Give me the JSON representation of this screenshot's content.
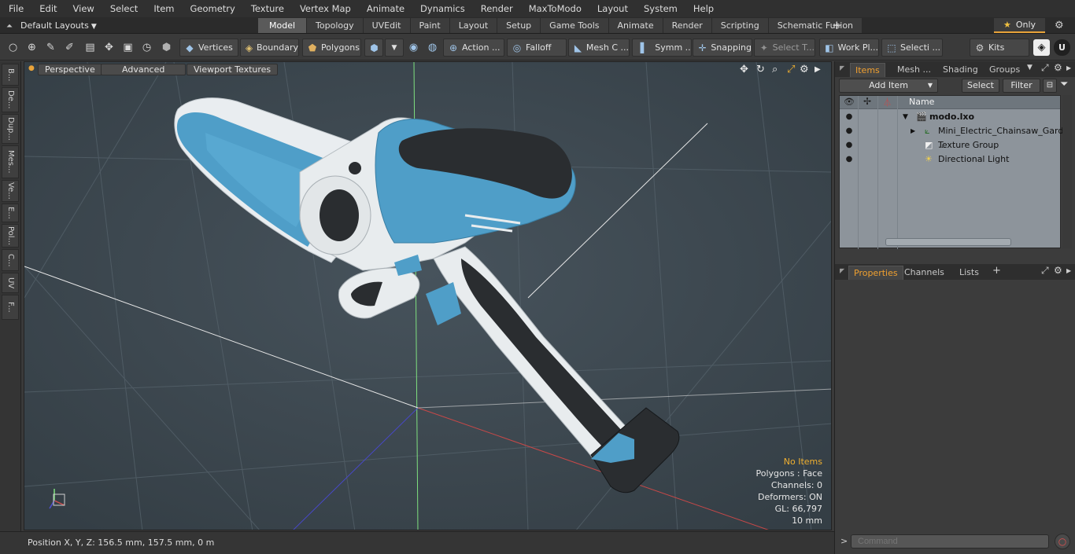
{
  "menu": [
    "File",
    "Edit",
    "View",
    "Select",
    "Item",
    "Geometry",
    "Texture",
    "Vertex Map",
    "Animate",
    "Dynamics",
    "Render",
    "MaxToModo",
    "Layout",
    "System",
    "Help"
  ],
  "layouts": {
    "selector": "Default Layouts",
    "tabs": [
      "Model",
      "Topology",
      "UVEdit",
      "Paint",
      "Layout",
      "Setup",
      "Game Tools",
      "Animate",
      "Render",
      "Scripting",
      "Schematic Fusion"
    ],
    "active_tab": "Model",
    "plus": "+",
    "only_label": "Only",
    "only_star": "★"
  },
  "toolbar": {
    "vertices": "Vertices",
    "boundary": "Boundary",
    "polygons": "Polygons",
    "action": "Action ...",
    "falloff": "Falloff",
    "mesh": "Mesh C ...",
    "symm": "Symm ...",
    "snapping": "Snapping",
    "select_t": "Select T...",
    "work_plane": "Work Pl...",
    "selection": "Selecti ...",
    "kits": "Kits"
  },
  "left_strip": [
    "B...",
    "De...",
    "Dup...",
    "Mes...",
    "Ve...",
    "E...",
    "Pol...",
    "C...",
    "UV",
    "F..."
  ],
  "viewport": {
    "view_mode": "Perspective",
    "shading": "Advanced",
    "textures": "Viewport Textures",
    "info": {
      "selection": "No Items",
      "polygons": "Polygons : Face",
      "channels": "Channels: 0",
      "deformers": "Deformers: ON",
      "gl": "GL: 66,797",
      "grid": "10 mm"
    }
  },
  "status": {
    "position": "Position X, Y, Z:   156.5 mm, 157.5 mm, 0 m"
  },
  "items_panel": {
    "tabs": [
      "Items",
      "Mesh ...",
      "Shading",
      "Groups"
    ],
    "active_tab": "Items",
    "add_item": "Add Item",
    "select": "Select",
    "filter": "Filter",
    "column_name": "Name",
    "rows": [
      {
        "name": "modo.lxo"
      },
      {
        "name": "Mini_Electric_Chainsaw_Gard ..."
      },
      {
        "name": "Texture Group"
      },
      {
        "name": "Directional Light"
      }
    ]
  },
  "properties_panel": {
    "tabs": [
      "Properties",
      "Channels",
      "Lists"
    ],
    "active_tab": "Properties",
    "plus": "+"
  },
  "command": {
    "placeholder": "Command",
    "prompt": ">"
  },
  "colors": {
    "accent": "#f0a030",
    "viewport_bg": "#3e4a52",
    "chainsaw_blue": "#4f9ec8",
    "chainsaw_white": "#e8ecee",
    "chainsaw_dark": "#2a2d30"
  }
}
